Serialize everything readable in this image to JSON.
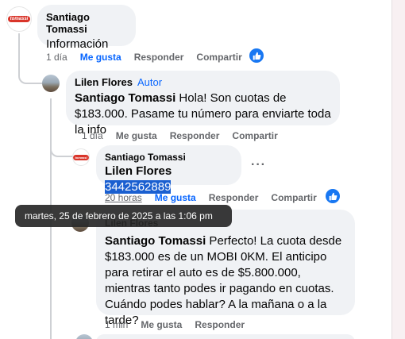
{
  "comment1": {
    "author": "Santiago Tomassi",
    "text": "Información",
    "avatar_logo": "tomassi",
    "time": "1 día",
    "like": "Me gusta",
    "reply": "Responder",
    "share": "Compartir"
  },
  "reply1": {
    "author": "Lilen Flores",
    "badge": "Autor",
    "mention": "Santiago Tomassi",
    "text": " Hola! Son cuotas de $183.000. Pasame tu número para enviarte toda la info",
    "time": "1 día",
    "like": "Me gusta",
    "reply": "Responder",
    "share": "Compartir"
  },
  "reply2": {
    "author": "Santiago Tomassi",
    "avatar_logo": "tomassi",
    "mention": "Lilen Flores",
    "phone": "3442562889",
    "more": "···",
    "time": "20 horas",
    "like": "Me gusta",
    "reply": "Responder",
    "share": "Compartir"
  },
  "tooltip": {
    "text": "martes, 25 de febrero de 2025 a las 1:06 pm"
  },
  "reply3": {
    "author": "Lilen Flores",
    "mention": "Santiago Tomassi",
    "text": " Perfecto! La cuota desde $183.000 es de un MOBI 0KM. El anticipo para retirar el auto es de $5.800.000, mientras tanto podes ir pagando en cuotas. Cuándo podes hablar? A la mañana o a la tarde?",
    "time": "1 min",
    "like": "Me gusta",
    "reply": "Responder"
  },
  "colors": {
    "accent": "#0866ff",
    "like_blue": "#1877f2",
    "bubble_bg": "#f0f2f5",
    "muted_text": "#65676b"
  }
}
